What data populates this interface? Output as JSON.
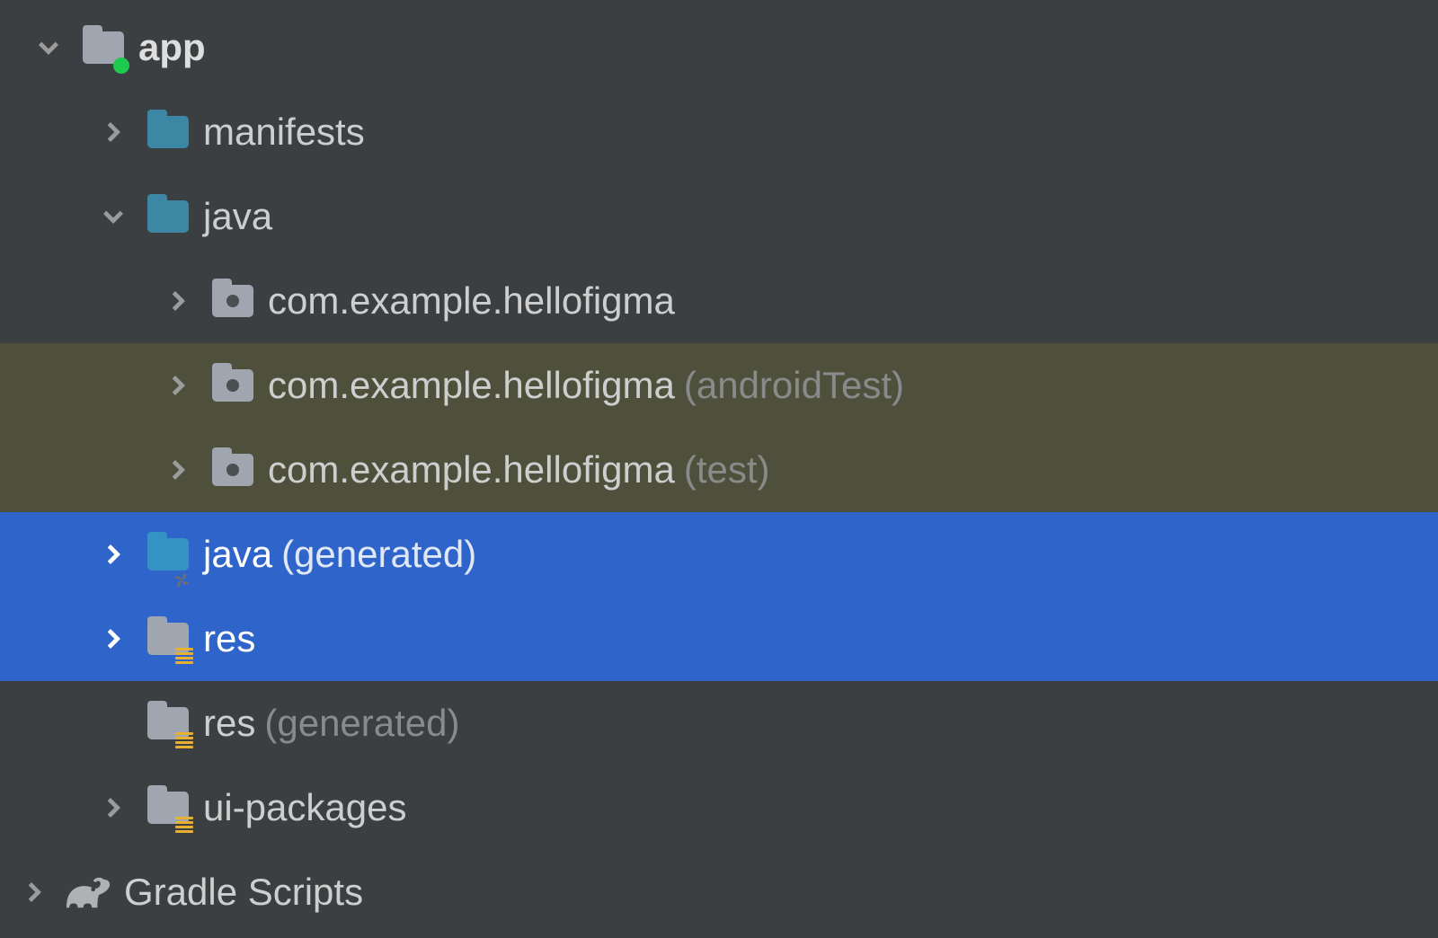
{
  "tree": {
    "app": {
      "label": "app",
      "manifests": {
        "label": "manifests"
      },
      "java": {
        "label": "java",
        "pkg_main": {
          "name": "com.example.hellofigma",
          "suffix": ""
        },
        "pkg_androidTest": {
          "name": "com.example.hellofigma",
          "suffix": "(androidTest)"
        },
        "pkg_test": {
          "name": "com.example.hellofigma",
          "suffix": "(test)"
        }
      },
      "java_gen": {
        "label": "java",
        "suffix": "(generated)"
      },
      "res": {
        "label": "res"
      },
      "res_gen": {
        "label": "res",
        "suffix": "(generated)"
      },
      "ui_packages": {
        "label": "ui-packages"
      }
    },
    "gradle": {
      "label": "Gradle Scripts"
    }
  }
}
